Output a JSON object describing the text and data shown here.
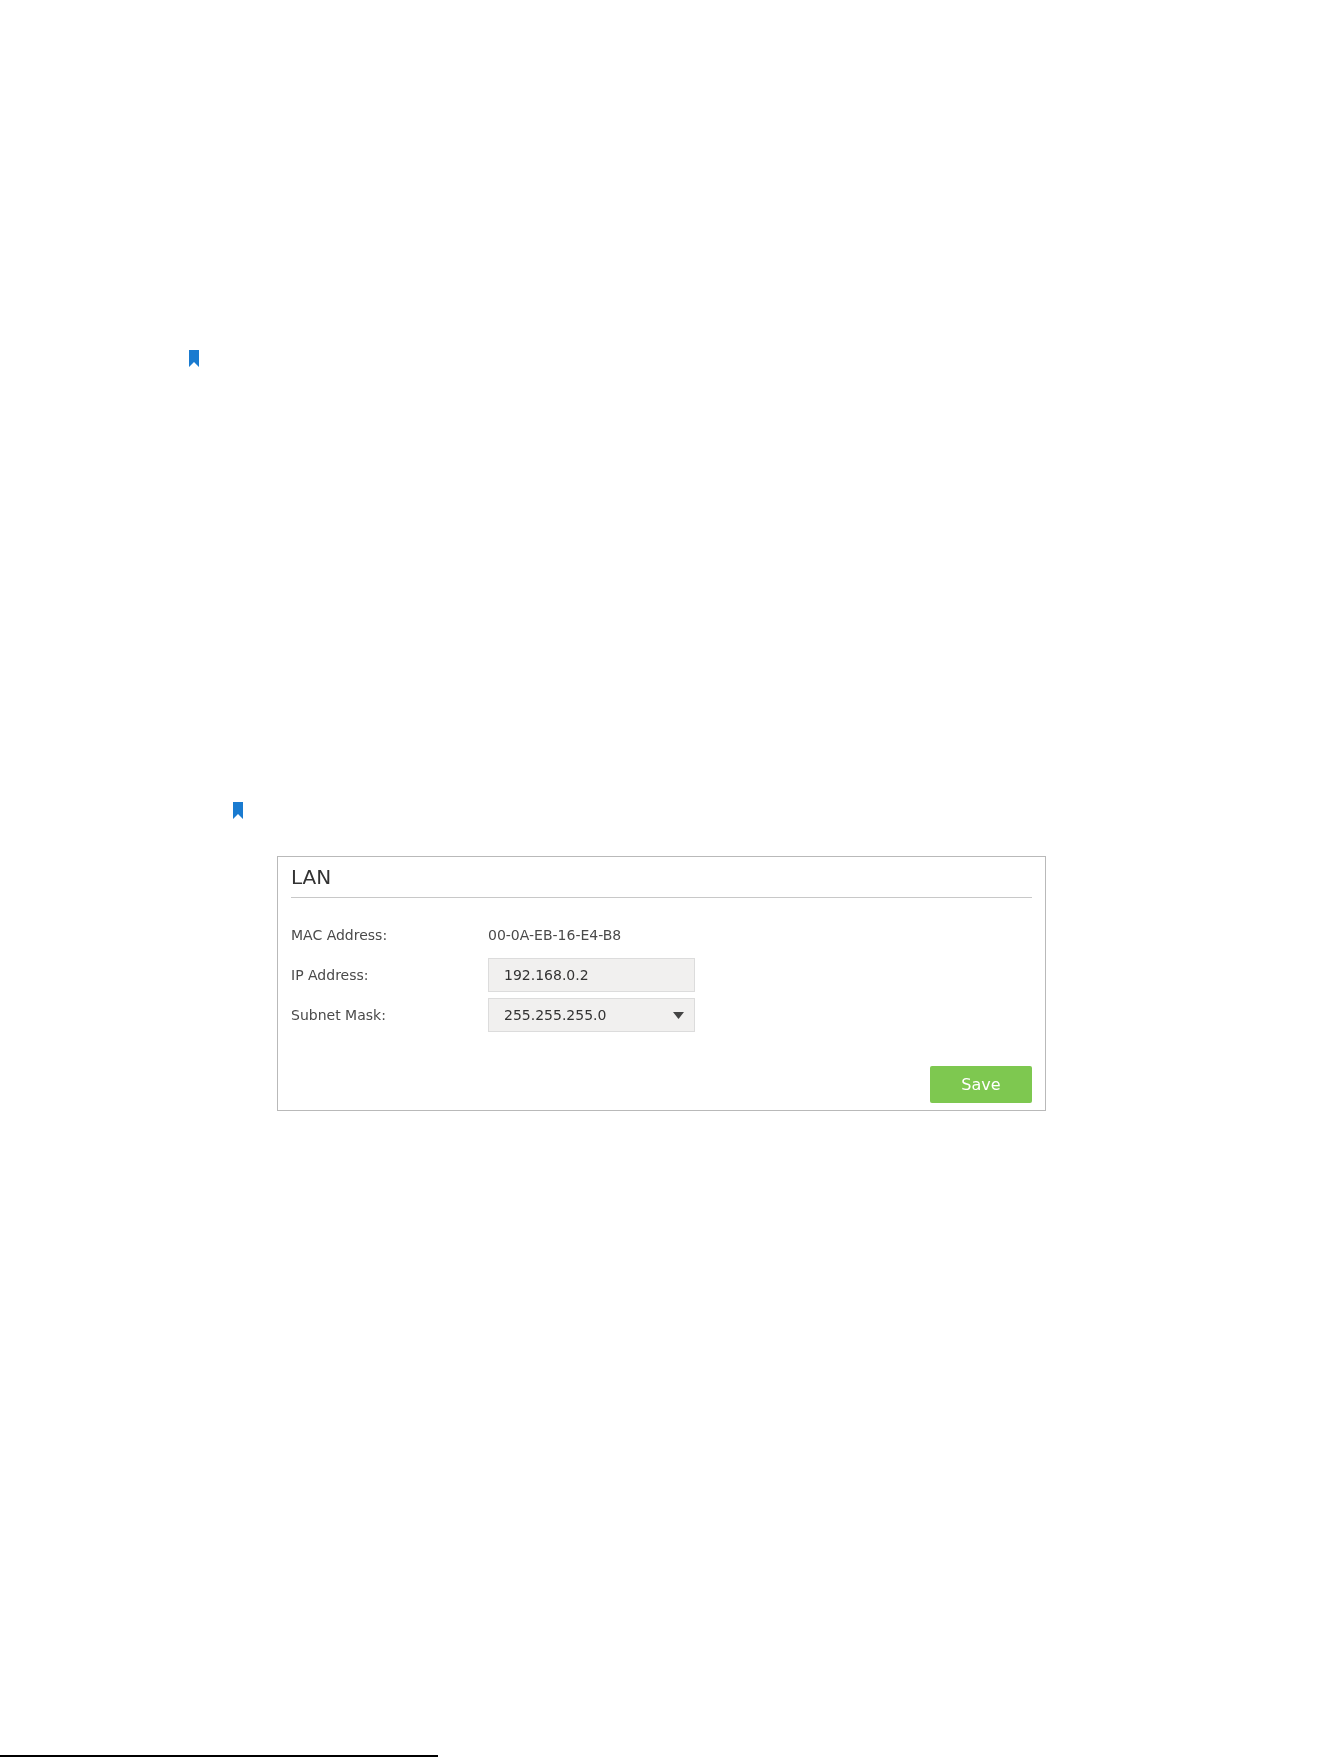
{
  "panel": {
    "title": "LAN",
    "fields": [
      {
        "label": "MAC Address:",
        "kind": "text",
        "value": "00-0A-EB-16-E4-B8"
      },
      {
        "label": "IP Address:",
        "kind": "input",
        "value": "192.168.0.2"
      },
      {
        "label": "Subnet Mask:",
        "kind": "select",
        "value": "255.255.255.0"
      }
    ],
    "buttons": [
      "Save"
    ]
  }
}
